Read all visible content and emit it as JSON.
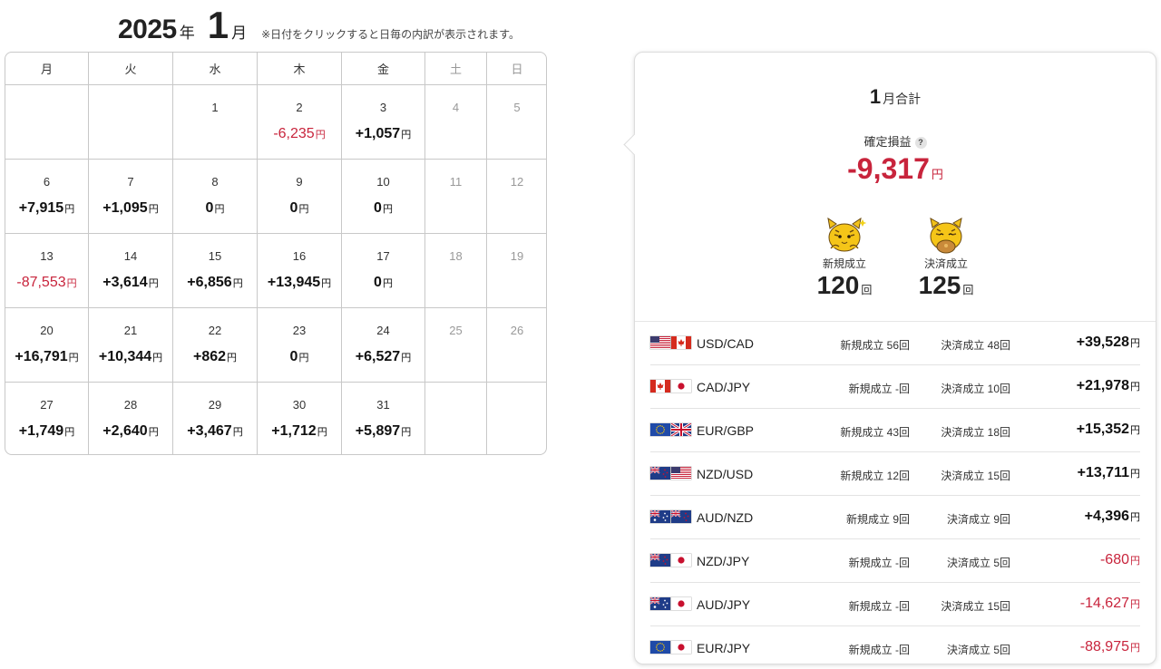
{
  "header": {
    "year": "2025",
    "year_unit": "年",
    "month": "1",
    "month_unit": "月",
    "note": "※日付をクリックすると日毎の内訳が表示されます。"
  },
  "calendar": {
    "weekdays": [
      "月",
      "火",
      "水",
      "木",
      "金",
      "土",
      "日"
    ],
    "yen": "円",
    "weeks": [
      [
        {
          "day": "",
          "amount": ""
        },
        {
          "day": "",
          "amount": ""
        },
        {
          "day": "1",
          "amount": ""
        },
        {
          "day": "2",
          "amount": "-6,235"
        },
        {
          "day": "3",
          "amount": "+1,057"
        },
        {
          "day": "4",
          "amount": ""
        },
        {
          "day": "5",
          "amount": ""
        }
      ],
      [
        {
          "day": "6",
          "amount": "+7,915"
        },
        {
          "day": "7",
          "amount": "+1,095"
        },
        {
          "day": "8",
          "amount": "0"
        },
        {
          "day": "9",
          "amount": "0"
        },
        {
          "day": "10",
          "amount": "0"
        },
        {
          "day": "11",
          "amount": ""
        },
        {
          "day": "12",
          "amount": ""
        }
      ],
      [
        {
          "day": "13",
          "amount": "-87,553"
        },
        {
          "day": "14",
          "amount": "+3,614"
        },
        {
          "day": "15",
          "amount": "+6,856"
        },
        {
          "day": "16",
          "amount": "+13,945"
        },
        {
          "day": "17",
          "amount": "0"
        },
        {
          "day": "18",
          "amount": ""
        },
        {
          "day": "19",
          "amount": ""
        }
      ],
      [
        {
          "day": "20",
          "amount": "+16,791"
        },
        {
          "day": "21",
          "amount": "+10,344"
        },
        {
          "day": "22",
          "amount": "+862"
        },
        {
          "day": "23",
          "amount": "0"
        },
        {
          "day": "24",
          "amount": "+6,527"
        },
        {
          "day": "25",
          "amount": ""
        },
        {
          "day": "26",
          "amount": ""
        }
      ],
      [
        {
          "day": "27",
          "amount": "+1,749"
        },
        {
          "day": "28",
          "amount": "+2,640"
        },
        {
          "day": "29",
          "amount": "+3,467"
        },
        {
          "day": "30",
          "amount": "+1,712"
        },
        {
          "day": "31",
          "amount": "+5,897"
        },
        {
          "day": "",
          "amount": ""
        },
        {
          "day": "",
          "amount": ""
        }
      ]
    ]
  },
  "summary": {
    "month": "1",
    "title_suffix": "月合計",
    "pnl_label": "確定損益",
    "help_icon": "?",
    "total": "-9,317",
    "yen": "円",
    "new_label": "新規成立",
    "new_count": "120",
    "close_label": "決済成立",
    "close_count": "125",
    "count_unit": "回",
    "mascot_icon": "tiger-mascot-icon"
  },
  "pairs": [
    {
      "name": "USD/CAD",
      "flags": [
        "us",
        "ca"
      ],
      "new": "新規成立 56回",
      "close": "決済成立 48回",
      "pnl": "+39,528"
    },
    {
      "name": "CAD/JPY",
      "flags": [
        "ca",
        "jp"
      ],
      "new": "新規成立 -回",
      "close": "決済成立 10回",
      "pnl": "+21,978"
    },
    {
      "name": "EUR/GBP",
      "flags": [
        "eu",
        "gb"
      ],
      "new": "新規成立 43回",
      "close": "決済成立 18回",
      "pnl": "+15,352"
    },
    {
      "name": "NZD/USD",
      "flags": [
        "nz",
        "us"
      ],
      "new": "新規成立 12回",
      "close": "決済成立 15回",
      "pnl": "+13,711"
    },
    {
      "name": "AUD/NZD",
      "flags": [
        "au",
        "nz"
      ],
      "new": "新規成立 9回",
      "close": "決済成立 9回",
      "pnl": "+4,396"
    },
    {
      "name": "NZD/JPY",
      "flags": [
        "nz",
        "jp"
      ],
      "new": "新規成立 -回",
      "close": "決済成立 5回",
      "pnl": "-680"
    },
    {
      "name": "AUD/JPY",
      "flags": [
        "au",
        "jp"
      ],
      "new": "新規成立 -回",
      "close": "決済成立 15回",
      "pnl": "-14,627"
    },
    {
      "name": "EUR/JPY",
      "flags": [
        "eu",
        "jp"
      ],
      "new": "新規成立 -回",
      "close": "決済成立 5回",
      "pnl": "-88,975"
    }
  ],
  "colors": {
    "negative": "#c8243c",
    "positive": "#111111",
    "weekend": "#999999",
    "border": "#c8c8c8"
  }
}
